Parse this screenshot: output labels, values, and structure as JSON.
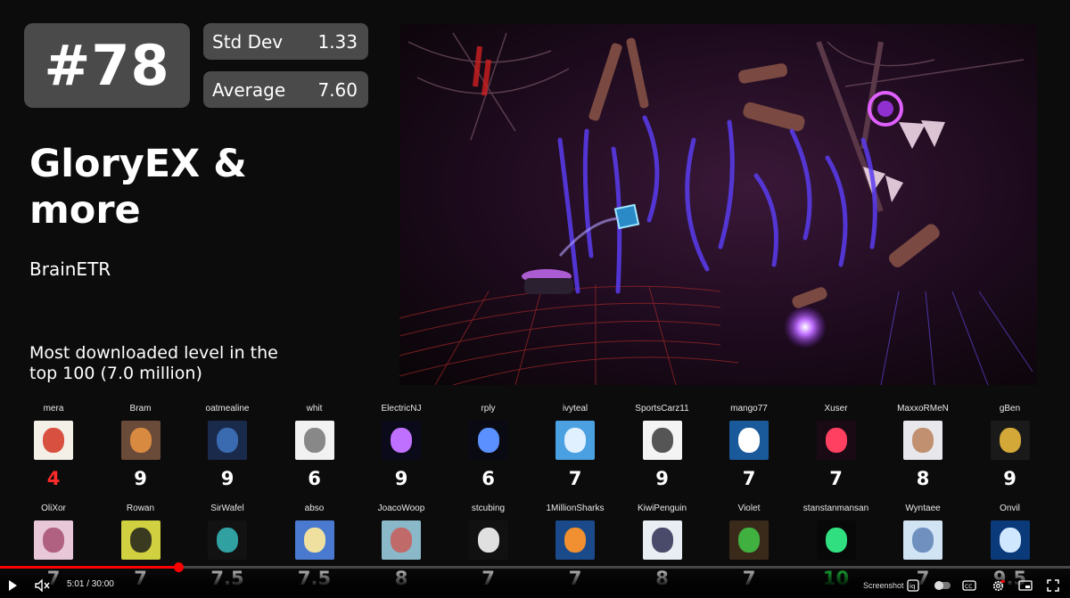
{
  "rank": "#78",
  "stats": {
    "std_dev_label": "Std Dev",
    "std_dev_value": "1.33",
    "average_label": "Average",
    "average_value": "7.60"
  },
  "level": {
    "title_line1": "GloryEX &",
    "title_line2": "more",
    "creator": "BrainETR",
    "fact_line1": "Most downloaded level in the",
    "fact_line2": "top 100 (7.0 million)"
  },
  "ratings_row1": [
    {
      "name": "mera",
      "score": "4",
      "color": "#ff2a2a"
    },
    {
      "name": "Bram",
      "score": "9",
      "color": "#ffffff"
    },
    {
      "name": "oatmealine",
      "score": "9",
      "color": "#ffffff"
    },
    {
      "name": "whit",
      "score": "6",
      "color": "#ffffff"
    },
    {
      "name": "ElectricNJ",
      "score": "9",
      "color": "#ffffff"
    },
    {
      "name": "rply",
      "score": "6",
      "color": "#ffffff"
    },
    {
      "name": "ivyteal",
      "score": "7",
      "color": "#ffffff"
    },
    {
      "name": "SportsCarz11",
      "score": "9",
      "color": "#ffffff"
    },
    {
      "name": "mango77",
      "score": "7",
      "color": "#ffffff"
    },
    {
      "name": "Xuser",
      "score": "7",
      "color": "#ffffff"
    },
    {
      "name": "MaxxoRMeN",
      "score": "8",
      "color": "#ffffff"
    },
    {
      "name": "gBen",
      "score": "9",
      "color": "#ffffff"
    }
  ],
  "ratings_row2": [
    {
      "name": "OliXor",
      "score": "7",
      "color": "#ffffff"
    },
    {
      "name": "Rowan",
      "score": "7",
      "color": "#ffffff"
    },
    {
      "name": "SirWafel",
      "score": "7.5",
      "color": "#ffffff"
    },
    {
      "name": "abso",
      "score": "7.5",
      "color": "#ffffff"
    },
    {
      "name": "JoacoWoop",
      "score": "8",
      "color": "#ffffff"
    },
    {
      "name": "stcubing",
      "score": "7",
      "color": "#ffffff"
    },
    {
      "name": "1MillionSharks",
      "score": "7",
      "color": "#ffffff"
    },
    {
      "name": "KiwiPenguin",
      "score": "8",
      "color": "#ffffff"
    },
    {
      "name": "Violet",
      "score": "7",
      "color": "#ffffff"
    },
    {
      "name": "stanstanmansan",
      "score": "10",
      "color": "#22dd44"
    },
    {
      "name": "Wyntaee",
      "score": "7",
      "color": "#ffffff"
    },
    {
      "name": "Onvil",
      "score": "9.5",
      "color": "#ffffff"
    }
  ],
  "player": {
    "time": "5:01 / 30:00",
    "progress_fraction": 0.167,
    "screenshot_label": "Screenshot",
    "accent_color": "#ff0000"
  }
}
